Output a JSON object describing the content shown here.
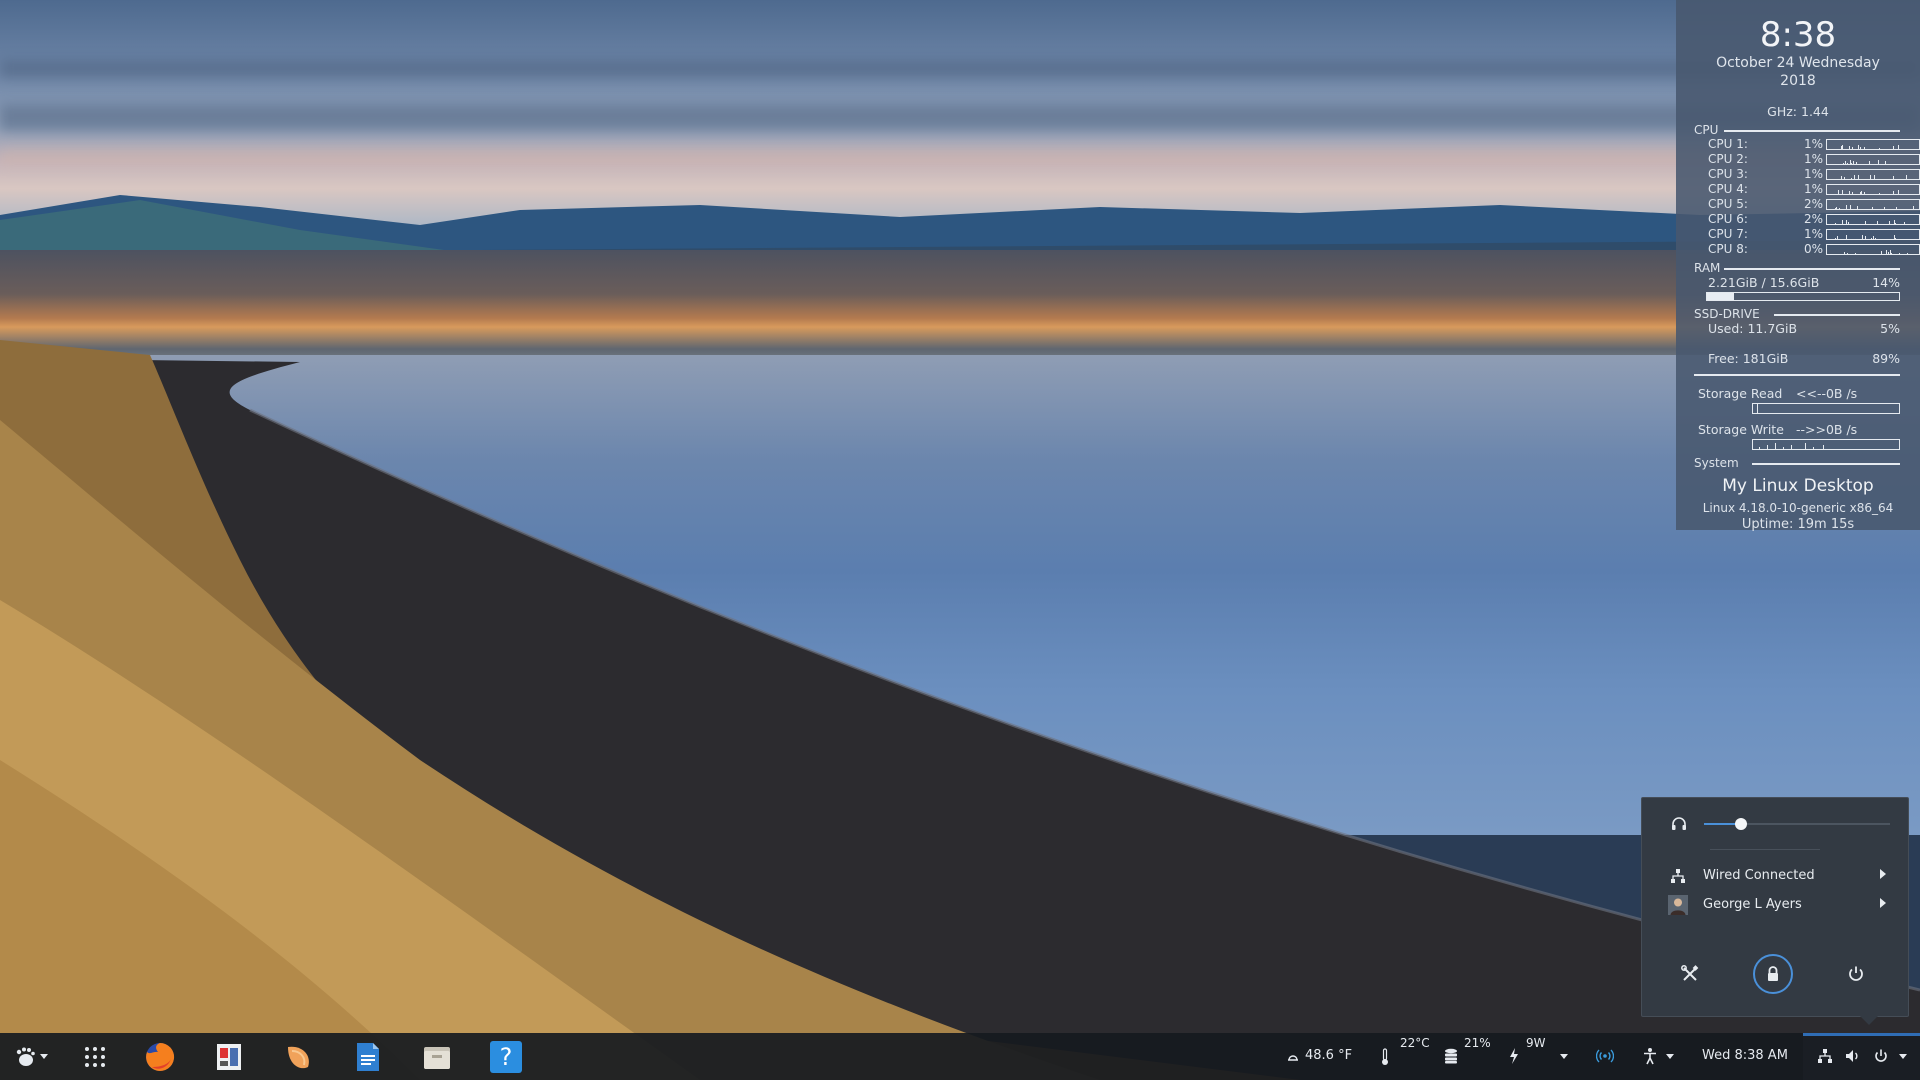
{
  "colors": {
    "accent": "#4a90d9",
    "panel": "#48586e",
    "taskbar": "#161a20",
    "popup": "#333a43"
  },
  "conky": {
    "time": "8:38",
    "date_line": "October 24 Wednesday",
    "year": "2018",
    "ghz": "GHz: 1.44",
    "cpu_header": "CPU",
    "cpus": [
      {
        "label": "CPU 1:",
        "pct": "1%",
        "level": 0.01
      },
      {
        "label": "CPU 2:",
        "pct": "1%",
        "level": 0.01
      },
      {
        "label": "CPU 3:",
        "pct": "1%",
        "level": 0.01
      },
      {
        "label": "CPU 4:",
        "pct": "1%",
        "level": 0.01
      },
      {
        "label": "CPU 5:",
        "pct": "2%",
        "level": 0.02
      },
      {
        "label": "CPU 6:",
        "pct": "2%",
        "level": 0.02
      },
      {
        "label": "CPU 7:",
        "pct": "1%",
        "level": 0.01
      },
      {
        "label": "CPU 8:",
        "pct": "0%",
        "level": 0.0
      }
    ],
    "ram_header": "RAM",
    "ram_usage": "2.21GiB / 15.6GiB",
    "ram_pct": "14%",
    "ram_level": 0.14,
    "ssd_header": "SSD-DRIVE",
    "ssd_used_label": "Used:  11.7GiB",
    "ssd_used_pct": "5%",
    "ssd_used_level": 0.05,
    "ssd_free_label": "Free:  181GiB",
    "ssd_free_pct": "89%",
    "ssd_free_level": 0.89,
    "storage_read_label": "Storage Read",
    "storage_read_value": "<<--0B  /s",
    "storage_write_label": "Storage Write",
    "storage_write_value": "-->>0B  /s",
    "system_header": "System",
    "hostname": "My Linux Desktop",
    "kernel": "Linux 4.18.0-10-generic x86_64",
    "uptime": "Uptime: 19m 15s"
  },
  "popup": {
    "volume_icon": "headphones-icon",
    "volume_level": 0.2,
    "network_label": "Wired Connected",
    "network_icon": "network-wired-icon",
    "user_label": "George L Ayers",
    "user_icon": "user-avatar-icon",
    "settings_icon": "settings-tools-icon",
    "lock_icon": "lock-icon",
    "power_icon": "power-icon"
  },
  "taskbar": {
    "menu_icon": "gnome-foot-icon",
    "apps_icon": "app-grid-icon",
    "launchers": [
      "firefox-icon",
      "document-viewer-icon",
      "fruit-app-icon",
      "text-editor-icon",
      "file-manager-icon",
      "help-icon"
    ],
    "help_label": "?",
    "weather": "48.6 °F",
    "temperature": "22°C",
    "disk_usage": "21%",
    "power_draw": "9W",
    "clock": "Wed  8:38 AM"
  }
}
